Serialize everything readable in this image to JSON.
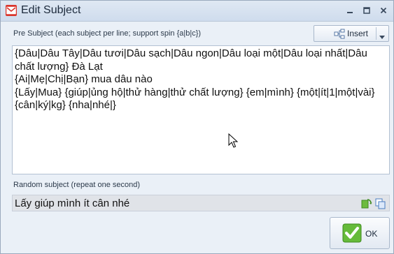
{
  "window": {
    "title": "Edit Subject",
    "app_icon": "mail-envelope-icon",
    "controls": [
      "minimize-icon",
      "maximize-icon",
      "close-icon"
    ]
  },
  "pre_subject": {
    "label": "Pre Subject (each subject per line; support spin {a|b|c})",
    "insert_label": "Insert",
    "content": "{Dâu|Dâu Tây|Dâu tươi|Dâu sạch|Dâu ngon|Dâu loại một|Dâu loại nhất|Dâu chất lượng} Đà Lạt\n{Ai|Mẹ|Chị|Bạn} mua dâu nào\n{Lấy|Mua} {giúp|ủng hộ|thử hàng|thử chất lượng} {em|mình} {một|ít|1|một|vài} {cân|ký|kg} {nha|nhé|}"
  },
  "random_subject": {
    "label": "Random subject (repeat one second)",
    "value": "Lấy giúp mình ít cân nhé",
    "icons": [
      "regenerate-icon",
      "copy-icon"
    ]
  },
  "ok_button": {
    "label": "OK"
  },
  "colors": {
    "title_bg": "#dfe8f3",
    "window_bg": "#eaf0f7",
    "app_icon": "#d9342b",
    "ok_check": "#55b030"
  }
}
